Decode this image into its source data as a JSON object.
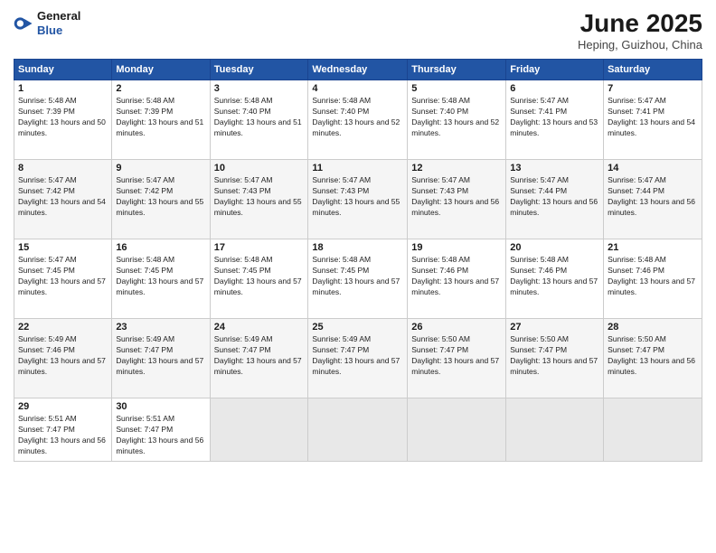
{
  "header": {
    "logo_general": "General",
    "logo_blue": "Blue",
    "month_title": "June 2025",
    "location": "Heping, Guizhou, China"
  },
  "weekdays": [
    "Sunday",
    "Monday",
    "Tuesday",
    "Wednesday",
    "Thursday",
    "Friday",
    "Saturday"
  ],
  "weeks": [
    [
      {
        "day": "1",
        "sunrise": "5:48 AM",
        "sunset": "7:39 PM",
        "daylight": "13 hours and 50 minutes."
      },
      {
        "day": "2",
        "sunrise": "5:48 AM",
        "sunset": "7:39 PM",
        "daylight": "13 hours and 51 minutes."
      },
      {
        "day": "3",
        "sunrise": "5:48 AM",
        "sunset": "7:40 PM",
        "daylight": "13 hours and 51 minutes."
      },
      {
        "day": "4",
        "sunrise": "5:48 AM",
        "sunset": "7:40 PM",
        "daylight": "13 hours and 52 minutes."
      },
      {
        "day": "5",
        "sunrise": "5:48 AM",
        "sunset": "7:40 PM",
        "daylight": "13 hours and 52 minutes."
      },
      {
        "day": "6",
        "sunrise": "5:47 AM",
        "sunset": "7:41 PM",
        "daylight": "13 hours and 53 minutes."
      },
      {
        "day": "7",
        "sunrise": "5:47 AM",
        "sunset": "7:41 PM",
        "daylight": "13 hours and 54 minutes."
      }
    ],
    [
      {
        "day": "8",
        "sunrise": "5:47 AM",
        "sunset": "7:42 PM",
        "daylight": "13 hours and 54 minutes."
      },
      {
        "day": "9",
        "sunrise": "5:47 AM",
        "sunset": "7:42 PM",
        "daylight": "13 hours and 55 minutes."
      },
      {
        "day": "10",
        "sunrise": "5:47 AM",
        "sunset": "7:43 PM",
        "daylight": "13 hours and 55 minutes."
      },
      {
        "day": "11",
        "sunrise": "5:47 AM",
        "sunset": "7:43 PM",
        "daylight": "13 hours and 55 minutes."
      },
      {
        "day": "12",
        "sunrise": "5:47 AM",
        "sunset": "7:43 PM",
        "daylight": "13 hours and 56 minutes."
      },
      {
        "day": "13",
        "sunrise": "5:47 AM",
        "sunset": "7:44 PM",
        "daylight": "13 hours and 56 minutes."
      },
      {
        "day": "14",
        "sunrise": "5:47 AM",
        "sunset": "7:44 PM",
        "daylight": "13 hours and 56 minutes."
      }
    ],
    [
      {
        "day": "15",
        "sunrise": "5:47 AM",
        "sunset": "7:45 PM",
        "daylight": "13 hours and 57 minutes."
      },
      {
        "day": "16",
        "sunrise": "5:48 AM",
        "sunset": "7:45 PM",
        "daylight": "13 hours and 57 minutes."
      },
      {
        "day": "17",
        "sunrise": "5:48 AM",
        "sunset": "7:45 PM",
        "daylight": "13 hours and 57 minutes."
      },
      {
        "day": "18",
        "sunrise": "5:48 AM",
        "sunset": "7:45 PM",
        "daylight": "13 hours and 57 minutes."
      },
      {
        "day": "19",
        "sunrise": "5:48 AM",
        "sunset": "7:46 PM",
        "daylight": "13 hours and 57 minutes."
      },
      {
        "day": "20",
        "sunrise": "5:48 AM",
        "sunset": "7:46 PM",
        "daylight": "13 hours and 57 minutes."
      },
      {
        "day": "21",
        "sunrise": "5:48 AM",
        "sunset": "7:46 PM",
        "daylight": "13 hours and 57 minutes."
      }
    ],
    [
      {
        "day": "22",
        "sunrise": "5:49 AM",
        "sunset": "7:46 PM",
        "daylight": "13 hours and 57 minutes."
      },
      {
        "day": "23",
        "sunrise": "5:49 AM",
        "sunset": "7:47 PM",
        "daylight": "13 hours and 57 minutes."
      },
      {
        "day": "24",
        "sunrise": "5:49 AM",
        "sunset": "7:47 PM",
        "daylight": "13 hours and 57 minutes."
      },
      {
        "day": "25",
        "sunrise": "5:49 AM",
        "sunset": "7:47 PM",
        "daylight": "13 hours and 57 minutes."
      },
      {
        "day": "26",
        "sunrise": "5:50 AM",
        "sunset": "7:47 PM",
        "daylight": "13 hours and 57 minutes."
      },
      {
        "day": "27",
        "sunrise": "5:50 AM",
        "sunset": "7:47 PM",
        "daylight": "13 hours and 57 minutes."
      },
      {
        "day": "28",
        "sunrise": "5:50 AM",
        "sunset": "7:47 PM",
        "daylight": "13 hours and 56 minutes."
      }
    ],
    [
      {
        "day": "29",
        "sunrise": "5:51 AM",
        "sunset": "7:47 PM",
        "daylight": "13 hours and 56 minutes."
      },
      {
        "day": "30",
        "sunrise": "5:51 AM",
        "sunset": "7:47 PM",
        "daylight": "13 hours and 56 minutes."
      },
      null,
      null,
      null,
      null,
      null
    ]
  ]
}
